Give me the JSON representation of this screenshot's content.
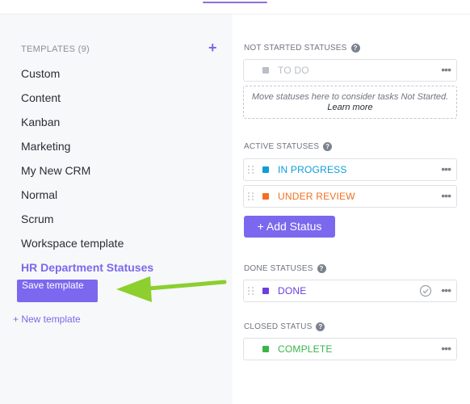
{
  "templates": {
    "header": "TEMPLATES (9)",
    "add_symbol": "+",
    "items": [
      {
        "label": "Custom"
      },
      {
        "label": "Content"
      },
      {
        "label": "Kanban"
      },
      {
        "label": "Marketing"
      },
      {
        "label": "My New CRM"
      },
      {
        "label": "Normal"
      },
      {
        "label": "Scrum"
      },
      {
        "label": "Workspace template"
      },
      {
        "label": "HR Department Statuses"
      }
    ],
    "save_button": "Save template",
    "new_template": "+ New template"
  },
  "sections": {
    "not_started": {
      "title": "NOT STARTED STATUSES",
      "statuses": [
        {
          "label": "TO DO",
          "color": "#b9bec7"
        }
      ],
      "hint_text": "Move statuses here to consider tasks Not Started.",
      "learn_more": "Learn more"
    },
    "active": {
      "title": "ACTIVE STATUSES",
      "statuses": [
        {
          "label": "IN PROGRESS",
          "color": "#0d9cd8"
        },
        {
          "label": "UNDER REVIEW",
          "color": "#f26f21"
        }
      ],
      "add_button": "+ Add Status"
    },
    "done": {
      "title": "DONE STATUSES",
      "statuses": [
        {
          "label": "DONE",
          "color": "#6b3fdf"
        }
      ]
    },
    "closed": {
      "title": "CLOSED STATUS",
      "statuses": [
        {
          "label": "COMPLETE",
          "color": "#3ab54a"
        }
      ]
    }
  },
  "colors": {
    "accent": "#7b68ee",
    "annotation_arrow": "#8ccf2e"
  },
  "icons": {
    "help": "question-circle",
    "more": "ellipsis-horizontal",
    "check": "check-circle",
    "drag": "drag-handle"
  }
}
